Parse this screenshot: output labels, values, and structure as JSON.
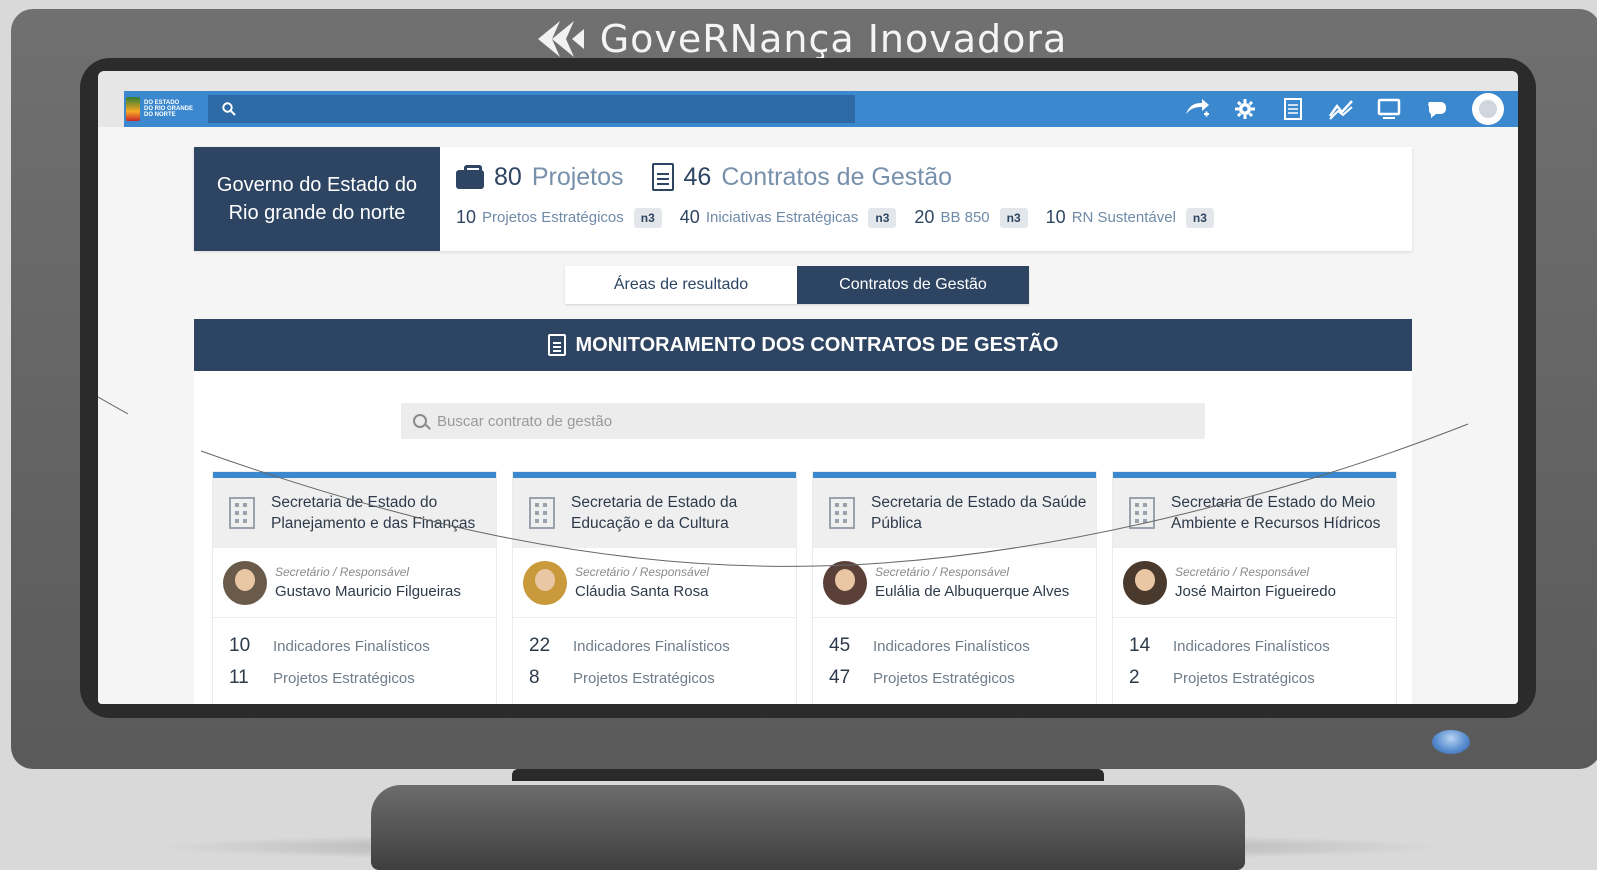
{
  "brand": {
    "title": "GoveRNança Inovadora"
  },
  "topbar": {
    "logo_lines": [
      "DO ESTADO",
      "DO RIO GRANDE",
      "DO NORTE"
    ],
    "icons": [
      "share-icon",
      "gear-icon",
      "document-icon",
      "chart-icon",
      "monitor-icon",
      "chat-icon",
      "user-avatar-icon"
    ]
  },
  "summary": {
    "org_name": "Governo do Estado do Rio grande do norte",
    "projects_count": "80",
    "projects_label": "Projetos",
    "contracts_count": "46",
    "contracts_label": "Contratos de Gestão",
    "items": [
      {
        "num": "10",
        "label": "Projetos Estratégicos",
        "badge": "n3"
      },
      {
        "num": "40",
        "label": "Iniciativas Estratégicas",
        "badge": "n3"
      },
      {
        "num": "20",
        "label": "BB 850",
        "badge": "n3"
      },
      {
        "num": "10",
        "label": "RN Sustentável",
        "badge": "n3"
      }
    ]
  },
  "tabs": {
    "areas": "Áreas de resultado",
    "contracts": "Contratos de Gestão"
  },
  "panel": {
    "title": "MONITORAMENTO DOS CONTRATOS DE GESTÃO",
    "search_placeholder": "Buscar contrato de gestão"
  },
  "cards": [
    {
      "title": "Secretaria de Estado do Planejamento e das Finanças",
      "role": "Secretário / Responsável",
      "name": "Gustavo Mauricio Filgueiras",
      "indicators": "10",
      "indicators_label": "Indicadores Finalísticos",
      "projects": "11",
      "projects_label": "Projetos Estratégicos"
    },
    {
      "title": "Secretaria de Estado da Educação e da Cultura",
      "role": "Secretário / Responsável",
      "name": "Cláudia Santa Rosa",
      "indicators": "22",
      "indicators_label": "Indicadores Finalísticos",
      "projects": "8",
      "projects_label": "Projetos Estratégicos"
    },
    {
      "title": "Secretaria de Estado da Saúde Pública",
      "role": "Secretário / Responsável",
      "name": "Eulália de Albuquerque Alves",
      "indicators": "45",
      "indicators_label": "Indicadores Finalísticos",
      "projects": "47",
      "projects_label": "Projetos Estratégicos"
    },
    {
      "title": "Secretaria de Estado do Meio Ambiente e Recursos Hídricos",
      "role": "Secretário / Responsável",
      "name": "José Mairton Figueiredo",
      "indicators": "14",
      "indicators_label": "Indicadores Finalísticos",
      "projects": "2",
      "projects_label": "Projetos Estratégicos"
    }
  ]
}
